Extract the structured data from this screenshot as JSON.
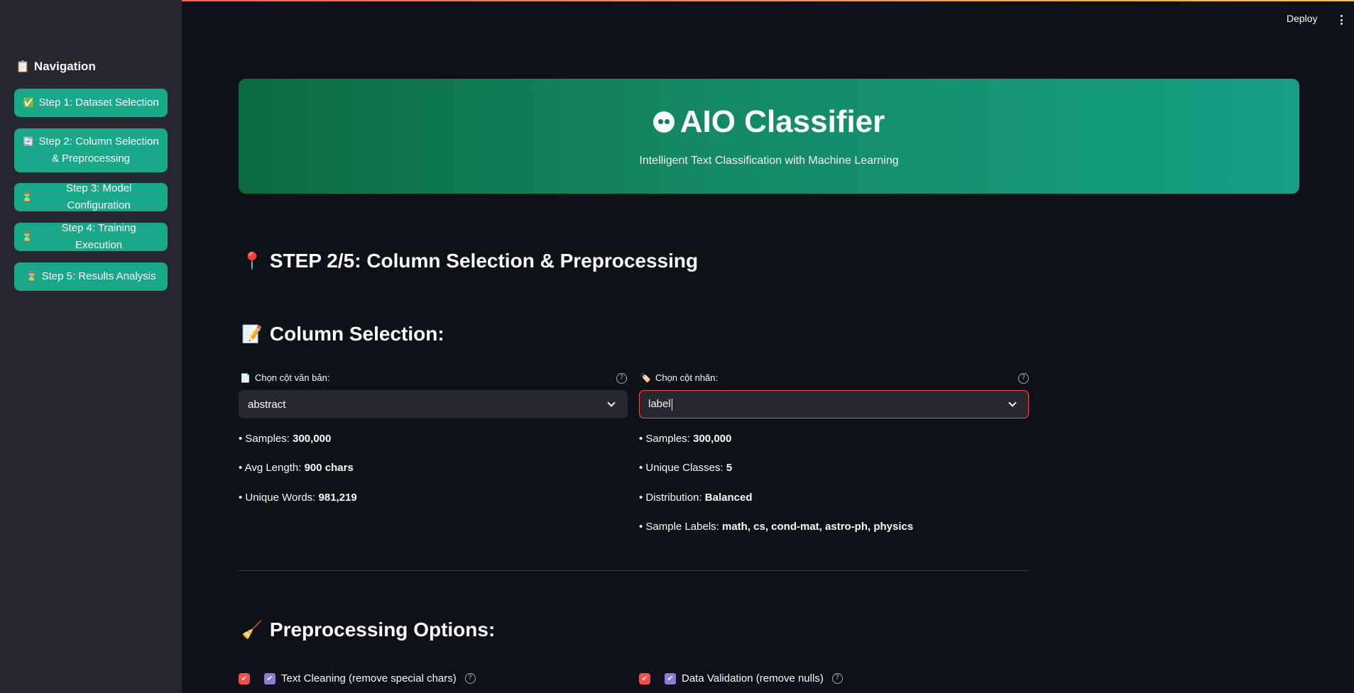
{
  "header": {
    "deploy_label": "Deploy",
    "menu_icon": "kebab-menu-icon"
  },
  "sidebar": {
    "title": "Navigation",
    "title_icon": "clipboard-icon",
    "items": [
      {
        "icon": "✅",
        "label": "Step 1: Dataset Selection"
      },
      {
        "icon": "🔄",
        "label": "Step 2: Column Selection & Preprocessing"
      },
      {
        "icon": "⏳",
        "label": "Step 3: Model Configuration"
      },
      {
        "icon": "⏳",
        "label": "Step 4: Training Execution"
      },
      {
        "icon": "⏳",
        "label": "Step 5: Results Analysis"
      }
    ]
  },
  "hero": {
    "title": "AIO Classifier",
    "subtitle": "Intelligent Text Classification with Machine Learning",
    "colors": {
      "start": "#0c6b40",
      "end": "#17a085"
    }
  },
  "step_heading": {
    "icon": "📍",
    "text": "STEP 2/5: Column Selection & Preprocessing"
  },
  "column_selection": {
    "icon": "📝",
    "heading": "Column Selection:",
    "text_column": {
      "icon": "📄",
      "label": "Chọn cột văn bản:",
      "value": "abstract",
      "stats": [
        {
          "label": "• Samples: ",
          "value": "300,000"
        },
        {
          "label": "• Avg Length: ",
          "value": "900 chars"
        },
        {
          "label": "• Unique Words: ",
          "value": "981,219"
        }
      ]
    },
    "label_column": {
      "icon": "🏷️",
      "label": "Chọn cột nhãn:",
      "value": "label",
      "stats": [
        {
          "label": "• Samples: ",
          "value": "300,000"
        },
        {
          "label": "• Unique Classes: ",
          "value": "5"
        },
        {
          "label": "• Distribution: ",
          "value": "Balanced"
        },
        {
          "label": "• Sample Labels: ",
          "value": "math, cs, cond-mat, astro-ph, physics"
        }
      ]
    }
  },
  "preprocessing": {
    "icon": "🧹",
    "heading": "Preprocessing Options:",
    "options": [
      {
        "label": "Text Cleaning (remove special chars)",
        "checked": true
      },
      {
        "label": "Data Validation (remove nulls)",
        "checked": true
      }
    ]
  },
  "colors": {
    "accent": "#1aa88a",
    "primary_red": "#ff4b4b",
    "background": "#0e1117",
    "sidebar": "#262730"
  }
}
